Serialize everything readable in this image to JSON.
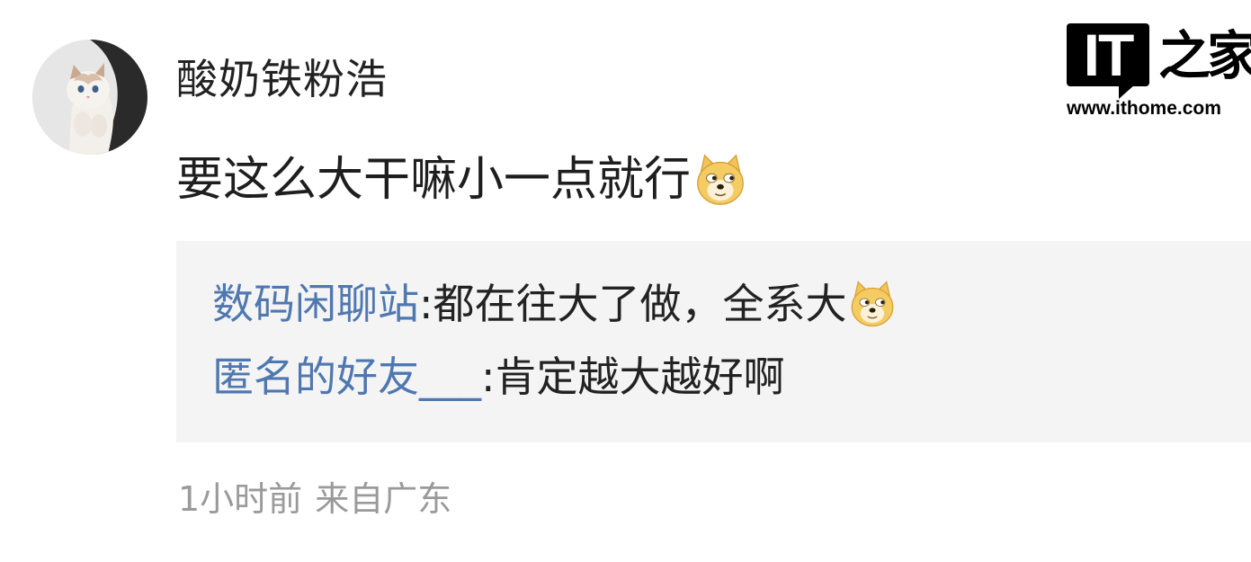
{
  "comment": {
    "username": "酸奶铁粉浩",
    "text": "要这么大干嘛小一点就行",
    "emoji_icon": "doge-emoji",
    "replies": [
      {
        "author": "数码闲聊站",
        "separator": ":",
        "text": "都在往大了做，全系大",
        "emoji_icon": "doge-emoji"
      },
      {
        "author": "匿名的好友___",
        "separator": ":",
        "text": "肯定越大越好啊"
      }
    ],
    "meta": {
      "time": "1小时前",
      "location": "来自广东"
    }
  },
  "watermark": {
    "logo_text": "IT",
    "brand_cn": "之家",
    "url": "www.ithome.com"
  },
  "colors": {
    "username": "#222222",
    "reply_author": "#4f78b0",
    "meta": "#9a9a9a",
    "reply_bg": "#f4f4f4"
  }
}
